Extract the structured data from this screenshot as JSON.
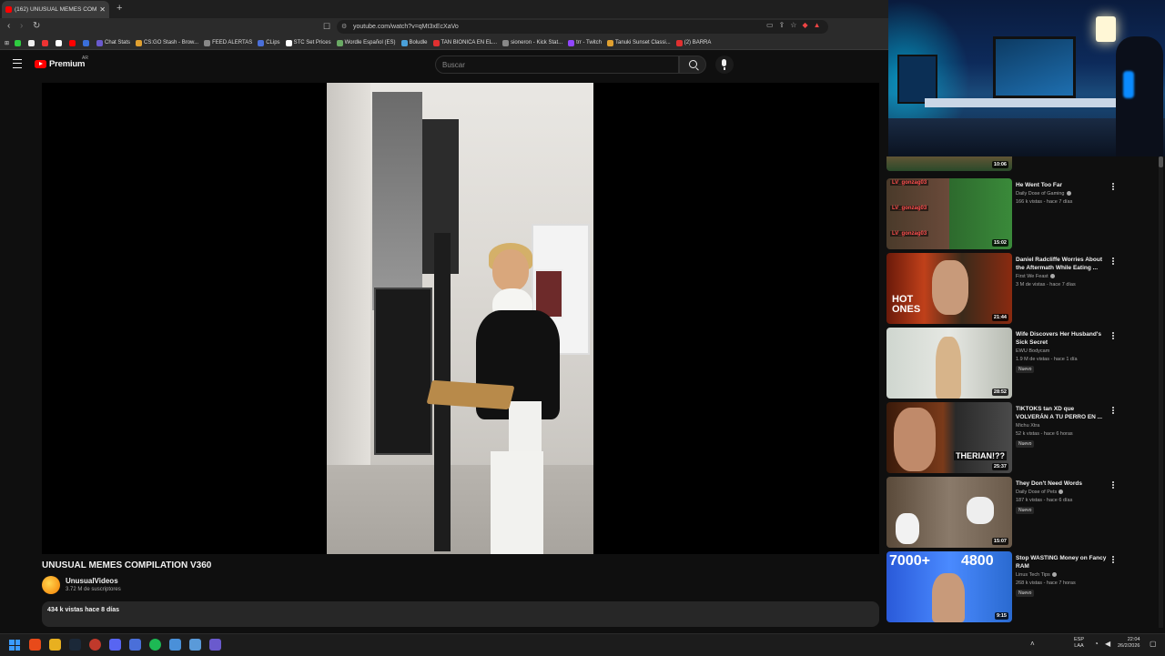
{
  "browser": {
    "tab_title": "(162) UNUSUAL MEMES COM",
    "url": "youtube.com/watch?v=qMt3xEcXaVo",
    "bookmarks": [
      {
        "label": "Chat Stats",
        "color": "#6a5acd"
      },
      {
        "label": "CS:GO Stash - Brow...",
        "color": "#e0a030"
      },
      {
        "label": "FEED ALERTAS",
        "color": "#888888"
      },
      {
        "label": "CLips",
        "color": "#4a6fd9"
      },
      {
        "label": "STC Set Prices",
        "color": "#ffffff"
      },
      {
        "label": "Wordle Español (ES)",
        "color": "#6aaa64"
      },
      {
        "label": "Boludle",
        "color": "#4aa0d9"
      },
      {
        "label": "TAN BIONICA EN EL...",
        "color": "#e03030"
      },
      {
        "label": "sioneron - Kick Stat...",
        "color": "#888888"
      },
      {
        "label": "trr - Twitch",
        "color": "#9146ff"
      },
      {
        "label": "Tanuki Sunset Classi...",
        "color": "#e0a030"
      },
      {
        "label": "(2) BARRA",
        "color": "#e03030"
      }
    ]
  },
  "youtube": {
    "logo_text": "Premium",
    "country_code": "AR",
    "search_placeholder": "Buscar",
    "video": {
      "title": "UNUSUAL MEMES COMPILATION V360",
      "channel": "UnusualVideos",
      "subscribers": "3.72 M de suscriptores",
      "views_date": "434 k vistas  hace 8 días"
    },
    "recommendations": [
      {
        "title": "",
        "channel": "",
        "meta": "",
        "duration": "10:06",
        "badge": ""
      },
      {
        "title": "He Went Too Far",
        "channel": "Daily Dose of Gaming",
        "meta": "166 k vistas - hace 7 días",
        "duration": "15:02",
        "badge": ""
      },
      {
        "title": "Daniel Radcliffe Worries About the Aftermath While Eating ...",
        "channel": "First We Feast",
        "meta": "3 M de vistas - hace 7 días",
        "duration": "21:44",
        "badge": ""
      },
      {
        "title": "Wife Discovers Her Husband's Sick Secret",
        "channel": "EWU Bodycam",
        "meta": "1.9 M de vistas - hace 1 día",
        "duration": "28:52",
        "badge": "Nuevo"
      },
      {
        "title": "TIKTOKS tan XD que VOLVERÁN A TU PERRO EN ...",
        "channel": "Michu Xtra",
        "meta": "52 k vistas - hace 6 horas",
        "duration": "25:37",
        "badge": "Nuevo"
      },
      {
        "title": "They Don't Need Words",
        "channel": "Daily Dose of Pets",
        "meta": "187 k vistas - hace 6 días",
        "duration": "15:07",
        "badge": "Nuevo"
      },
      {
        "title": "Stop WASTING Money on Fancy RAM",
        "channel": "Linus Tech Tips",
        "meta": "268 k vistas - hace 7 horas",
        "duration": "9:15",
        "badge": "Nuevo"
      }
    ],
    "thumb_text": {
      "hot_ones": "HOT ONES",
      "therian": "THERIAN!??",
      "ram_left": "7000+",
      "ram_right": "4800",
      "lv_tag": "LV_gonzag03"
    }
  },
  "taskbar": {
    "lang_line1": "ESP",
    "lang_line2": "LAA",
    "time": "22:04",
    "date": "26/2/2026"
  }
}
